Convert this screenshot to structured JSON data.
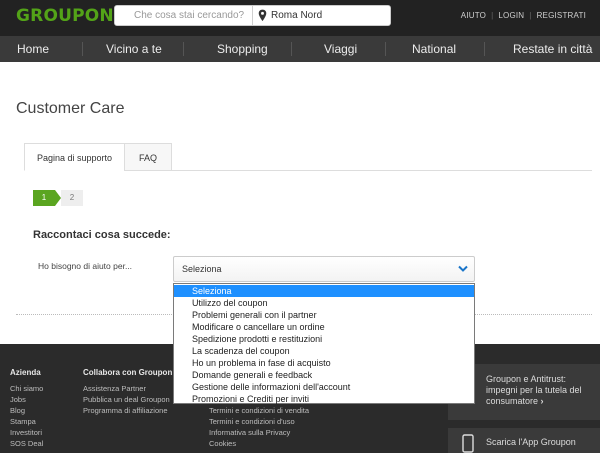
{
  "header": {
    "logo": "GROUPON",
    "search_placeholder": "Che cosa stai cercando?",
    "location_value": "Roma Nord",
    "links": [
      "AIUTO",
      "LOGIN",
      "REGISTRATI"
    ]
  },
  "nav": [
    "Home",
    "Vicino a te",
    "Shopping",
    "Viaggi",
    "National",
    "Restate in città"
  ],
  "page": {
    "title": "Customer Care",
    "tabs": [
      "Pagina di supporto",
      "FAQ"
    ],
    "steps": [
      "1",
      "2"
    ],
    "section_title": "Raccontaci cosa succede:",
    "field_label": "Ho bisogno di aiuto per...",
    "select_value": "Seleziona",
    "options": [
      "Seleziona",
      "Utilizzo del coupon",
      "Problemi generali con il partner",
      "Modificare o cancellare un ordine",
      "Spedizione prodotti e restituzioni",
      "La scadenza del coupon",
      "Ho un problema in fase di acquisto",
      "Domande generali e feedback",
      "Gestione delle informazioni dell'account",
      "Promozioni e Crediti per inviti"
    ]
  },
  "footer": {
    "col1": {
      "title": "Azienda",
      "links": [
        "Chi siamo",
        "Jobs",
        "Blog",
        "Stampa",
        "Investitori",
        "SOS Deal"
      ]
    },
    "col2": {
      "title": "Collabora con Groupon",
      "links": [
        "Assistenza Partner",
        "Pubblica un deal Groupon",
        "Programma di affiliazione"
      ]
    },
    "col3": {
      "links": [
        "Termini e condizioni di vendita",
        "Termini e condizioni d'uso",
        "Informativa sulla Privacy",
        "Cookies"
      ]
    },
    "promo1": "Groupon e Antitrust: impegni per la tutela del consumatore",
    "promo2": "Scarica l'App Groupon"
  },
  "colors": {
    "brand": "#53a318",
    "topbar": "#222222",
    "navbar": "#3a3a3a",
    "selected_option": "#1e90ff"
  }
}
